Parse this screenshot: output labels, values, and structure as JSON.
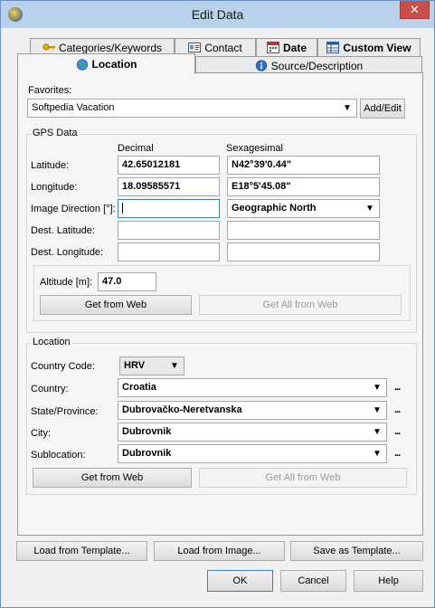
{
  "window": {
    "title": "Edit Data",
    "close_glyph": "✕"
  },
  "tabs": {
    "row1": [
      {
        "label": "Categories/Keywords",
        "icon": "key-icon"
      },
      {
        "label": "Contact",
        "icon": "contact-card-icon"
      },
      {
        "label": "Date",
        "icon": "calendar-icon"
      },
      {
        "label": "Custom View",
        "icon": "table-view-icon"
      }
    ],
    "row2": [
      {
        "label": "Location",
        "icon": "globe-icon",
        "active": true
      },
      {
        "label": "Source/Description",
        "icon": "info-icon"
      }
    ]
  },
  "favorites": {
    "label": "Favorites:",
    "value": "Softpedia Vacation",
    "add_edit": "Add/Edit"
  },
  "gps": {
    "group_label": "GPS Data",
    "col_decimal": "Decimal",
    "col_sexagesimal": "Sexagesimal",
    "latitude_label": "Latitude:",
    "latitude_decimal": "42.65012181",
    "latitude_sexagesimal": "N42°39'0.44\"",
    "longitude_label": "Longitude:",
    "longitude_decimal": "18.09585571",
    "longitude_sexagesimal": "E18°5'45.08\"",
    "direction_label": "Image Direction [°]:",
    "direction_value": "",
    "direction_ref": "Geographic North",
    "dest_lat_label": "Dest. Latitude:",
    "dest_lon_label": "Dest. Longitude:",
    "altitude_label": "Altitude [m]:",
    "altitude_value": "47.0",
    "get_from_web": "Get from Web",
    "get_all_from_web": "Get All from Web"
  },
  "location": {
    "group_label": "Location",
    "country_code_label": "Country Code:",
    "country_code": "HRV",
    "country_label": "Country:",
    "country": "Croatia",
    "state_label": "State/Province:",
    "state": "Dubrovačko-Neretvanska",
    "city_label": "City:",
    "city": "Dubrovnik",
    "sublocation_label": "Sublocation:",
    "sublocation": "Dubrovnik",
    "more": "...",
    "get_from_web": "Get from Web",
    "get_all_from_web": "Get All from Web"
  },
  "footer": {
    "load_template": "Load from Template...",
    "load_image": "Load from Image...",
    "save_template": "Save as Template...",
    "ok": "OK",
    "cancel": "Cancel",
    "help": "Help"
  }
}
